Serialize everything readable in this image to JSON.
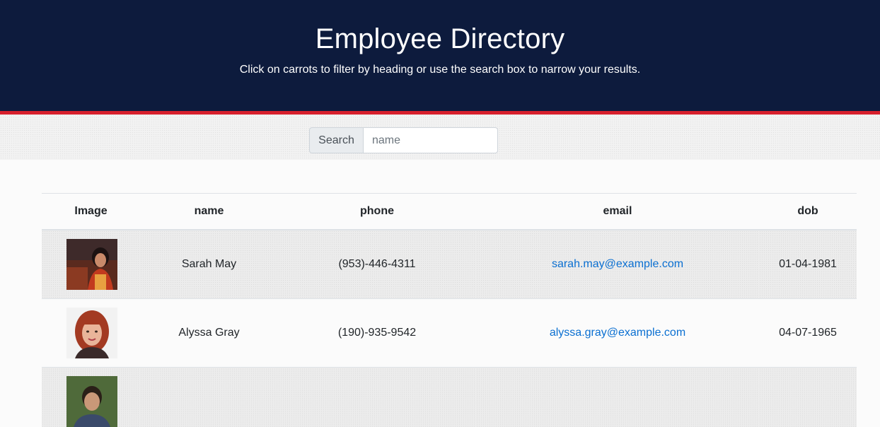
{
  "header": {
    "title": "Employee Directory",
    "subtitle": "Click on carrots to filter by heading or use the search box to narrow your results."
  },
  "search": {
    "label": "Search",
    "placeholder": "name",
    "value": ""
  },
  "table": {
    "columns": [
      "Image",
      "name",
      "phone",
      "email",
      "dob"
    ],
    "rows": [
      {
        "image": "employee-photo",
        "name": "Sarah May",
        "phone": "(953)-446-4311",
        "email": "sarah.may@example.com",
        "dob": "01-04-1981"
      },
      {
        "image": "employee-photo",
        "name": "Alyssa Gray",
        "phone": "(190)-935-9542",
        "email": "alyssa.gray@example.com",
        "dob": "04-07-1965"
      },
      {
        "image": "employee-photo",
        "name": "",
        "phone": "",
        "email": "",
        "dob": ""
      }
    ]
  },
  "colors": {
    "header_bg": "#0d1b3d",
    "accent_stripe": "#d61f2c",
    "link": "#0a6fd1"
  }
}
